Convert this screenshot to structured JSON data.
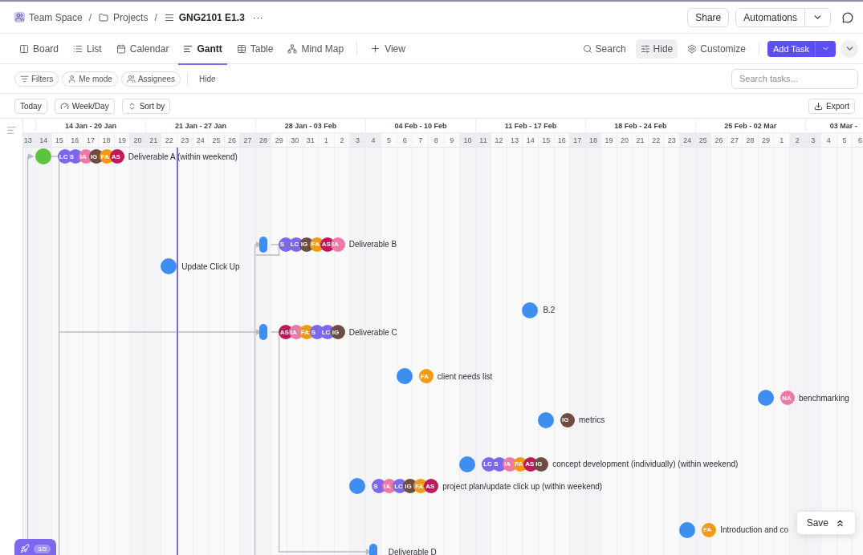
{
  "breadcrumb": [
    {
      "kind": "link",
      "label": "Team Space"
    },
    {
      "kind": "separator",
      "label": "/"
    },
    {
      "kind": "link",
      "label": "Projects"
    },
    {
      "kind": "separator",
      "label": "/"
    },
    {
      "kind": "current",
      "label": "GNG2101 E1.3"
    }
  ],
  "more": "···",
  "header_actions": {
    "share": "Share",
    "automations": "Automations"
  },
  "views": [
    {
      "label": "Board",
      "selected": false
    },
    {
      "label": "List",
      "selected": false
    },
    {
      "label": "Calendar",
      "selected": false
    },
    {
      "label": "Gantt",
      "selected": true
    },
    {
      "label": "Table",
      "selected": false
    },
    {
      "label": "Mind Map",
      "selected": false
    }
  ],
  "add_view": "View",
  "view_actions": [
    {
      "label": "Search",
      "selected": false
    },
    {
      "label": "Hide",
      "selected": true
    },
    {
      "label": "Customize",
      "selected": false
    }
  ],
  "add_task": "Add Task",
  "filters": [
    {
      "label": "Filters"
    },
    {
      "label": "Me mode"
    },
    {
      "label": "Assignees"
    }
  ],
  "hide_filter": "Hide",
  "search": {
    "placeholder": "Search tasks..."
  },
  "gantt_controls": [
    {
      "label": "Today"
    },
    {
      "label": "Week/Day"
    },
    {
      "label": "Sort by"
    }
  ],
  "export": "Export",
  "timeline": {
    "weeks": [
      "14 Jan - 20 Jan",
      "21 Jan - 27 Jan",
      "28 Jan - 03 Feb",
      "04 Feb - 10 Feb",
      "11 Feb - 17 Feb",
      "18 Feb - 24 Feb",
      "25 Feb - 02 Mar",
      "03 Mar -"
    ],
    "days": [
      {
        "label": "13",
        "weekend": true
      },
      {
        "label": "14",
        "weekend": true
      },
      {
        "label": "15",
        "weekend": false
      },
      {
        "label": "16",
        "weekend": false
      },
      {
        "label": "17",
        "weekend": false
      },
      {
        "label": "18",
        "weekend": false
      },
      {
        "label": "19",
        "weekend": false
      },
      {
        "label": "20",
        "weekend": true
      },
      {
        "label": "21",
        "weekend": true
      },
      {
        "label": "22",
        "weekend": false
      },
      {
        "label": "23",
        "weekend": false
      },
      {
        "label": "24",
        "weekend": false
      },
      {
        "label": "25",
        "weekend": false
      },
      {
        "label": "26",
        "weekend": false
      },
      {
        "label": "27",
        "weekend": true
      },
      {
        "label": "28",
        "weekend": true
      },
      {
        "label": "29",
        "weekend": false
      },
      {
        "label": "30",
        "weekend": false
      },
      {
        "label": "31",
        "weekend": false
      },
      {
        "label": "1",
        "weekend": false
      },
      {
        "label": "2",
        "weekend": false
      },
      {
        "label": "3",
        "weekend": true
      },
      {
        "label": "4",
        "weekend": true
      },
      {
        "label": "5",
        "weekend": false
      },
      {
        "label": "6",
        "weekend": false
      },
      {
        "label": "7",
        "weekend": false
      },
      {
        "label": "8",
        "weekend": false
      },
      {
        "label": "9",
        "weekend": false
      },
      {
        "label": "10",
        "weekend": true
      },
      {
        "label": "11",
        "weekend": true
      },
      {
        "label": "12",
        "weekend": false
      },
      {
        "label": "13",
        "weekend": false
      },
      {
        "label": "14",
        "weekend": false
      },
      {
        "label": "15",
        "weekend": false
      },
      {
        "label": "16",
        "weekend": false
      },
      {
        "label": "17",
        "weekend": true
      },
      {
        "label": "18",
        "weekend": true
      },
      {
        "label": "19",
        "weekend": false
      },
      {
        "label": "20",
        "weekend": false
      },
      {
        "label": "21",
        "weekend": false
      },
      {
        "label": "22",
        "weekend": false
      },
      {
        "label": "23",
        "weekend": false
      },
      {
        "label": "24",
        "weekend": true
      },
      {
        "label": "25",
        "weekend": true
      },
      {
        "label": "26",
        "weekend": false
      },
      {
        "label": "27",
        "weekend": false
      },
      {
        "label": "28",
        "weekend": false
      },
      {
        "label": "29",
        "weekend": false
      },
      {
        "label": "1",
        "weekend": false
      },
      {
        "label": "2",
        "weekend": true
      },
      {
        "label": "3",
        "weekend": true
      },
      {
        "label": "4",
        "weekend": false
      },
      {
        "label": "5",
        "weekend": false
      },
      {
        "label": "6",
        "weekend": false
      }
    ]
  },
  "tasks": [
    {
      "kind": "milestone",
      "color": "#5cc33d",
      "label": "Deliverable A (within weekend)",
      "assignees": [
        {
          "initials": "LC",
          "color": "#7b68ee"
        },
        {
          "initials": "S",
          "color": "#7b68ee"
        },
        {
          "initials": "IA",
          "color": "#ee78a6"
        },
        {
          "initials": "IG",
          "color": "#6d4c41"
        },
        {
          "initials": "FA",
          "color": "#f39a12"
        },
        {
          "initials": "AS",
          "color": "#c2185b"
        }
      ]
    },
    {
      "kind": "bar",
      "color": "#3d8ef0",
      "label": "Deliverable B",
      "assignees": [
        {
          "initials": "S",
          "color": "#7b68ee"
        },
        {
          "initials": "LC",
          "color": "#7b68ee"
        },
        {
          "initials": "IG",
          "color": "#6d4c41"
        },
        {
          "initials": "FA",
          "color": "#f39a12"
        },
        {
          "initials": "AS",
          "color": "#c2185b"
        },
        {
          "initials": "IA",
          "color": "#ee78a6"
        }
      ]
    },
    {
      "kind": "milestone",
      "color": "#3d8ef0",
      "label": "Update Click Up"
    },
    {
      "kind": "milestone",
      "color": "#3d8ef0",
      "label": "B.2"
    },
    {
      "kind": "bar",
      "color": "#3d8ef0",
      "label": "Deliverable C",
      "assignees": [
        {
          "initials": "AS",
          "color": "#c2185b"
        },
        {
          "initials": "IA",
          "color": "#ee78a6"
        },
        {
          "initials": "FA",
          "color": "#f39a12"
        },
        {
          "initials": "S",
          "color": "#7b68ee"
        },
        {
          "initials": "LC",
          "color": "#7b68ee"
        },
        {
          "initials": "IG",
          "color": "#6d4c41"
        }
      ]
    },
    {
      "kind": "milestone",
      "color": "#3d8ef0",
      "label": "client needs list",
      "assignees": [
        {
          "initials": "FA",
          "color": "#f39a12"
        }
      ]
    },
    {
      "kind": "milestone",
      "color": "#3d8ef0",
      "label": "benchmarking",
      "assignees": [
        {
          "initials": "NA",
          "color": "#ee78a6"
        }
      ]
    },
    {
      "kind": "milestone",
      "color": "#3d8ef0",
      "label": "metrics",
      "assignees": [
        {
          "initials": "IG",
          "color": "#6d4c41"
        }
      ]
    },
    {
      "kind": "milestone",
      "color": "#3d8ef0",
      "label": "concept development (individually) (within weekend)",
      "assignees": [
        {
          "initials": "LC",
          "color": "#7b68ee"
        },
        {
          "initials": "S",
          "color": "#7b68ee"
        },
        {
          "initials": "IA",
          "color": "#ee78a6"
        },
        {
          "initials": "FA",
          "color": "#f39a12"
        },
        {
          "initials": "AS",
          "color": "#c2185b"
        },
        {
          "initials": "IG",
          "color": "#6d4c41"
        }
      ]
    },
    {
      "kind": "milestone",
      "color": "#3d8ef0",
      "label": "project plan/update click up (within weekend)",
      "assignees": [
        {
          "initials": "S",
          "color": "#7b68ee"
        },
        {
          "initials": "IA",
          "color": "#ee78a6"
        },
        {
          "initials": "LC",
          "color": "#7b68ee"
        },
        {
          "initials": "IG",
          "color": "#6d4c41"
        },
        {
          "initials": "FA",
          "color": "#f39a12"
        },
        {
          "initials": "AS",
          "color": "#c2185b"
        }
      ]
    },
    {
      "kind": "milestone",
      "color": "#3d8ef0",
      "label": "Introduction and co",
      "assignees": [
        {
          "initials": "FA",
          "color": "#f39a12"
        }
      ]
    },
    {
      "kind": "bar",
      "color": "#3d8ef0",
      "label": "Deliverable D"
    }
  ],
  "save": "Save",
  "progress": "3/5"
}
